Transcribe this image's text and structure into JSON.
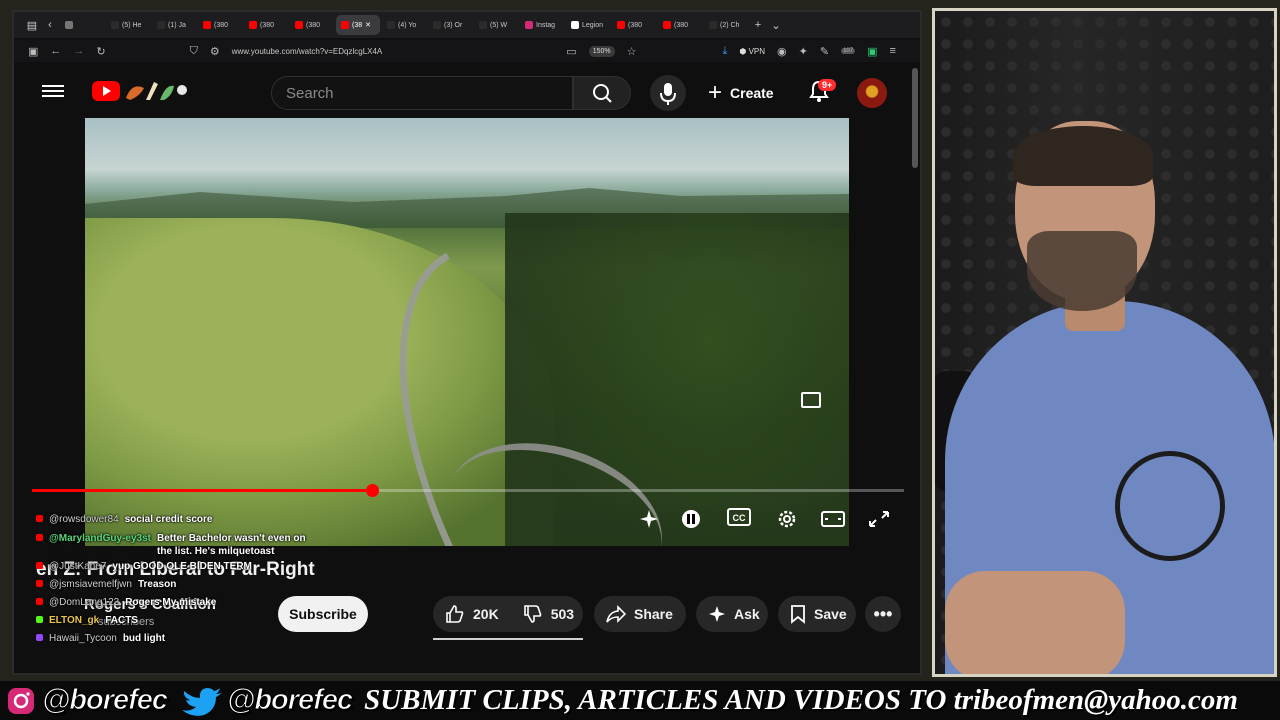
{
  "browser": {
    "tabs": [
      {
        "label": "",
        "color": "#777777"
      },
      {
        "label": "(5) He",
        "color": "#2b2b2b"
      },
      {
        "label": "(1) Ja",
        "color": "#2b2b2b"
      },
      {
        "label": "(380",
        "color": "#ff0000"
      },
      {
        "label": "(380",
        "color": "#ff0000"
      },
      {
        "label": "(380",
        "color": "#ff0000"
      },
      {
        "label": "(38",
        "color": "#ff0000"
      },
      {
        "label": "(4) Yo",
        "color": "#2b2b2b"
      },
      {
        "label": "(3) Or",
        "color": "#2b2b2b"
      },
      {
        "label": "(5) W",
        "color": "#2b2b2b"
      },
      {
        "label": "Instag",
        "color": "#d62976"
      },
      {
        "label": "Legion",
        "color": "#ffffff"
      },
      {
        "label": "(380",
        "color": "#ff0000"
      },
      {
        "label": "(380",
        "color": "#ff0000"
      },
      {
        "label": "(2) Ch",
        "color": "#2b2b2b"
      }
    ],
    "url": "www.youtube.com/watch?v=EDqzlcgLX4A",
    "zoom": "150%",
    "vpn_label": "VPN",
    "extension_badge": "107"
  },
  "youtube": {
    "search_placeholder": "Search",
    "create_label": "Create",
    "notification_count": "9+",
    "title_visible": "en Z: From Liberal to Far-Right",
    "channel_visible": "Rogers's Coalition",
    "subs_visible": "subscribers",
    "subscribe_label": "Subscribe",
    "likes": "20K",
    "dislikes": "503",
    "share_label": "Share",
    "ask_label": "Ask",
    "save_label": "Save",
    "progress_fraction": 0.39
  },
  "chat": [
    {
      "platform": "youtube",
      "user": "@rowsdower84",
      "message": "social credit score"
    },
    {
      "platform": "youtube",
      "user": "@MarylandGuy-ey3st",
      "message": "Better Bachelor wasn't even on the list. He's milquetoast",
      "user_style": "green"
    },
    {
      "platform": "youtube",
      "user": "@JustKane7",
      "message": "yup GOOD OLE BIDEN TERM"
    },
    {
      "platform": "youtube",
      "user": "@jsmsiavemelfjwn",
      "message": "Treason"
    },
    {
      "platform": "youtube",
      "user": "@DomLang123",
      "message": "Rogers My mistake"
    },
    {
      "platform": "kick",
      "user": "ELTON_gk",
      "message": "FACTS",
      "user_style": "gold"
    },
    {
      "platform": "twitch",
      "user": "Hawaii_Tycoon",
      "message": "bud light"
    }
  ],
  "banner": {
    "instagram_handle": "@borefec",
    "twitter_handle": "@borefec",
    "slogan": "SUBMIT CLIPS, ARTICLES AND VIDEOS TO tribeofmen@yahoo.com"
  },
  "colors": {
    "youtube_red": "#ff0000",
    "kick_green": "#53fc18",
    "twitch_purple": "#9146ff",
    "instagram_pink": "#d62976",
    "twitter_blue": "#1da1f2"
  }
}
